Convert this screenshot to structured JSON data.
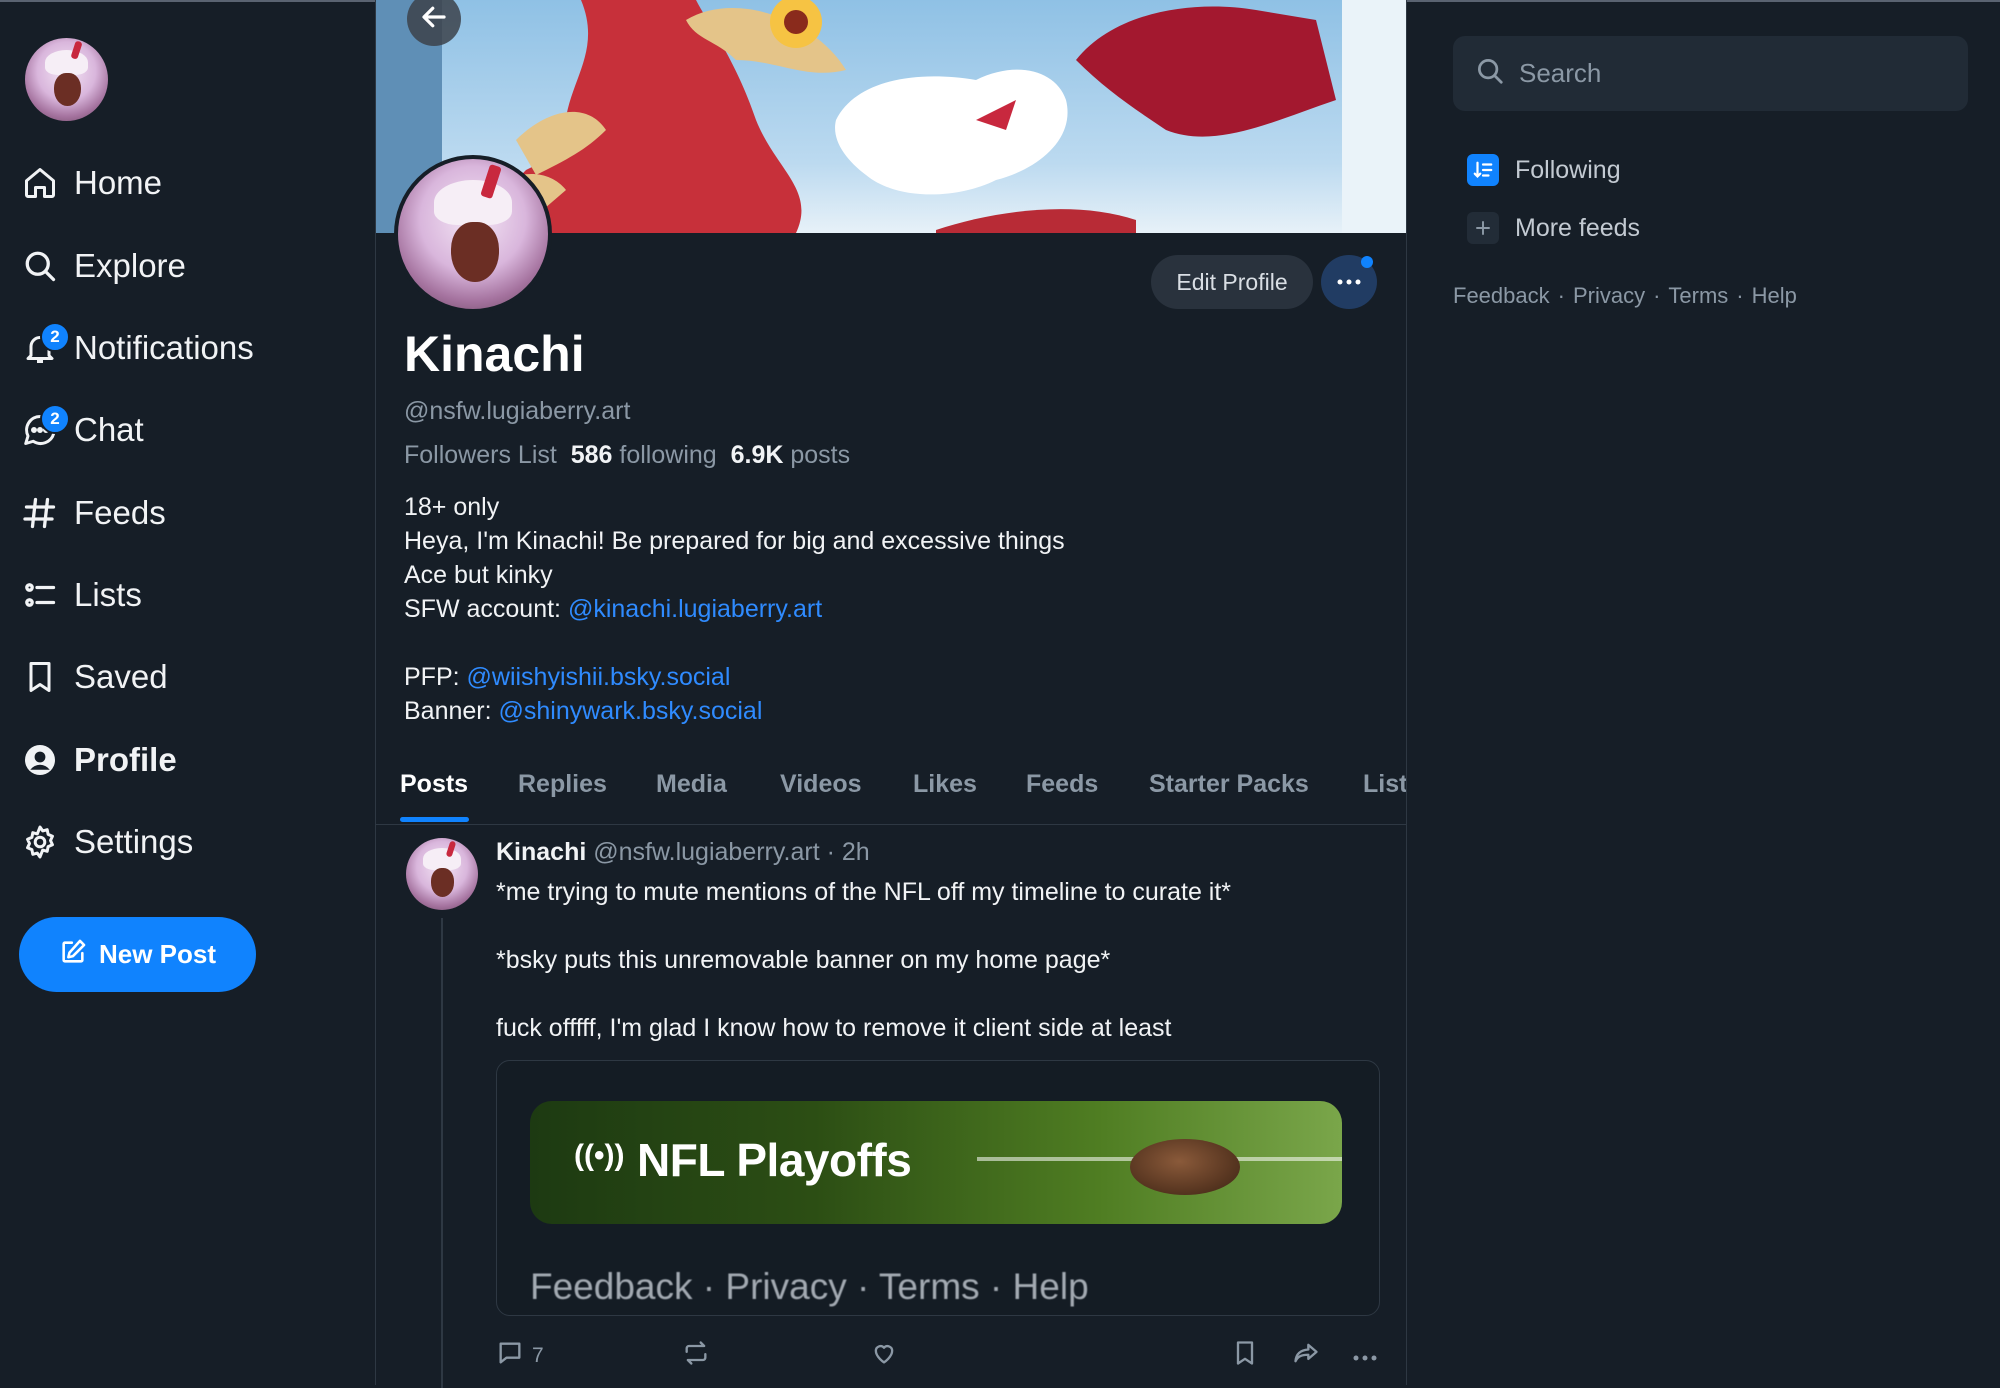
{
  "colors": {
    "background": "#161e27",
    "accent": "#1083fe",
    "link": "#2f8bff",
    "muted": "#8b98a5"
  },
  "nav": {
    "items": [
      {
        "label": "Home",
        "icon": "home-icon"
      },
      {
        "label": "Explore",
        "icon": "search-icon"
      },
      {
        "label": "Notifications",
        "icon": "bell-icon",
        "badge": "2"
      },
      {
        "label": "Chat",
        "icon": "chat-icon",
        "badge": "2"
      },
      {
        "label": "Feeds",
        "icon": "hash-icon"
      },
      {
        "label": "Lists",
        "icon": "list-icon"
      },
      {
        "label": "Saved",
        "icon": "bookmark-icon"
      },
      {
        "label": "Profile",
        "icon": "profile-icon",
        "active": true
      },
      {
        "label": "Settings",
        "icon": "gear-icon"
      }
    ],
    "new_post": "New Post"
  },
  "profile": {
    "name": "Kinachi",
    "handle": "@nsfw.lugiaberry.art",
    "edit_button": "Edit Profile",
    "followers_label": "Followers List",
    "following_count": "586",
    "following_label": "following",
    "posts_count": "6.9K",
    "posts_label": "posts",
    "bio": {
      "line1": "18+ only",
      "line2": "Heya, I'm Kinachi! Be prepared for big and excessive things",
      "line3": "Ace but kinky",
      "sfw_prefix": "SFW account: ",
      "sfw_link": "@kinachi.lugiaberry.art",
      "pfp_prefix": "PFP: ",
      "pfp_link": "@wiishyishii.bsky.social",
      "banner_prefix": "Banner: ",
      "banner_link": "@shinywark.bsky.social"
    }
  },
  "tabs": [
    "Posts",
    "Replies",
    "Media",
    "Videos",
    "Likes",
    "Feeds",
    "Starter Packs",
    "Lists"
  ],
  "post": {
    "author": "Kinachi",
    "handle": "@nsfw.lugiaberry.art",
    "time": "· 2h",
    "text": [
      "*me trying to mute mentions of the NFL off my timeline to curate it*",
      "",
      "*bsky puts this unremovable banner on my home page*",
      "",
      "fuck offfff, I'm glad I know how to remove it client side at least"
    ],
    "embed": {
      "live_icon": "((•))",
      "title": "NFL Playoffs",
      "footer": [
        "Feedback",
        "Privacy",
        "Terms",
        "Help"
      ]
    },
    "reply_count": "7"
  },
  "right": {
    "search_placeholder": "Search",
    "feeds": [
      {
        "label": "Following",
        "icon": "following-feed-icon"
      },
      {
        "label": "More feeds",
        "icon": "plus-icon"
      }
    ],
    "footer": [
      "Feedback",
      "Privacy",
      "Terms",
      "Help"
    ]
  }
}
